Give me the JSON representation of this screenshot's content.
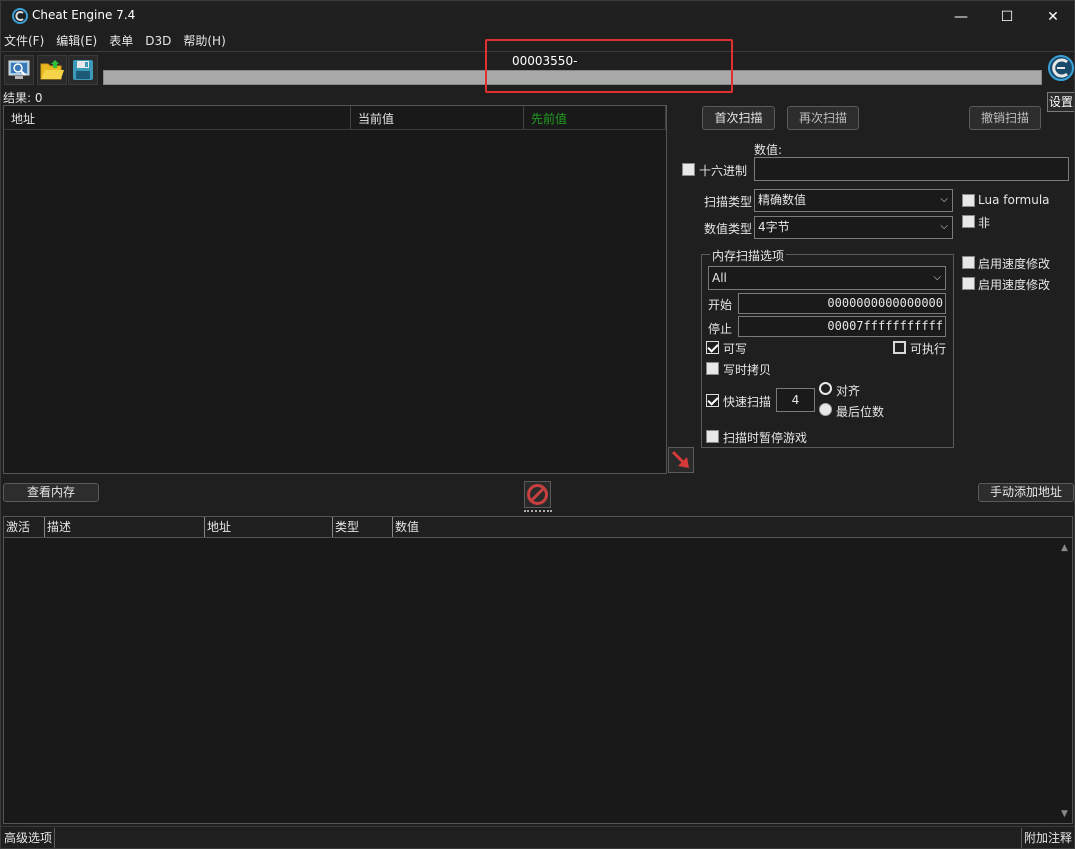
{
  "window": {
    "title": "Cheat Engine 7.4",
    "minimize_glyph": "—",
    "maximize_glyph": "☐",
    "close_glyph": "✕"
  },
  "menu": [
    "文件(F)",
    "编辑(E)",
    "表单",
    "D3D",
    "帮助(H)"
  ],
  "toolbar": {
    "process_name": "00003550-",
    "settings_label": "设置",
    "icons": [
      "open-process-icon",
      "open-file-icon",
      "save-file-icon"
    ]
  },
  "results": {
    "label": "结果: 0"
  },
  "found_list": {
    "columns": [
      "地址",
      "当前值",
      "先前值"
    ],
    "previous_value_color": "#1f9e1f"
  },
  "scan": {
    "first_scan_label": "首次扫描",
    "next_scan_label": "再次扫描",
    "undo_scan_label": "撤销扫描",
    "value_label": "数值:",
    "hex_label": "十六进制",
    "value": "",
    "scan_type_label": "扫描类型",
    "scan_type_value": "精确数值",
    "value_type_label": "数值类型",
    "value_type_value": "4字节",
    "lua_formula_label": "Lua formula",
    "not_label": "非",
    "speedhack1_label": "启用速度修改",
    "speedhack2_label": "启用速度修改"
  },
  "memory_options": {
    "title": "内存扫描选项",
    "region_value": "All",
    "start_label": "开始",
    "start_value": "0000000000000000",
    "stop_label": "停止",
    "stop_value": "00007fffffffffff",
    "writable_label": "可写",
    "executable_label": "可执行",
    "copy_on_write_label": "写时拷贝",
    "fast_scan_label": "快速扫描",
    "fast_scan_value": "4",
    "align_label": "对齐",
    "last_digits_label": "最后位数",
    "pause_game_label": "扫描时暂停游戏"
  },
  "bottom": {
    "view_memory_label": "查看内存",
    "add_address_label": "手动添加地址"
  },
  "address_list": {
    "columns": [
      "激活",
      "描述",
      "地址",
      "类型",
      "数值"
    ]
  },
  "statusbar": {
    "advanced_label": "高级选项",
    "comments_label": "附加注释"
  },
  "colors": {
    "highlight": "#e03030",
    "arrow": "#d63a3a"
  }
}
